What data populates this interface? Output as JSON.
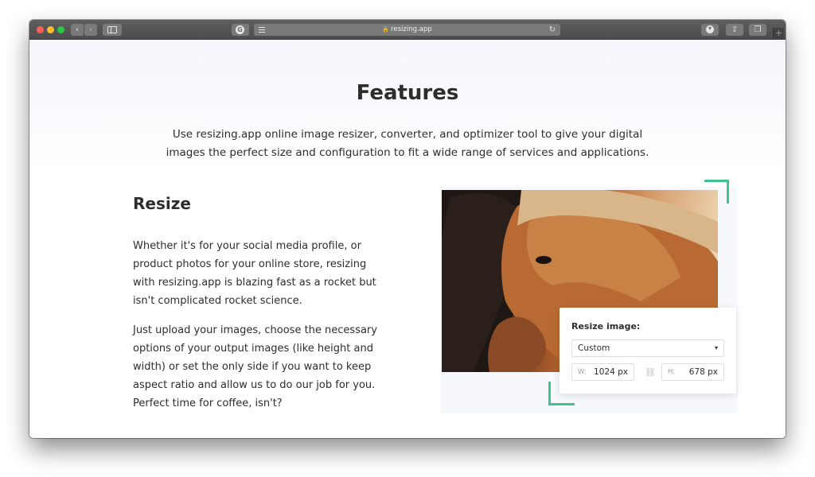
{
  "browser": {
    "url": "resizing.app",
    "lock_icon": "lock-icon",
    "reload_icon": "reload-icon",
    "back_icon": "chevron-left-icon",
    "forward_icon": "chevron-right-icon",
    "download_icon": "download-icon",
    "share_icon": "share-icon",
    "tabs_icon": "tabs-icon",
    "new_tab_icon": "plus-icon"
  },
  "features": {
    "title": "Features",
    "subtitle": "Use resizing.app online image resizer, converter, and optimizer tool to give your digital images the perfect size and configuration to fit a wide range of services and applications."
  },
  "resize_section": {
    "title": "Resize",
    "paragraph_1": "Whether it's for your social media profile, or product photos for your online store, resizing with resizing.app is blazing fast as a rocket but isn't complicated rocket science.",
    "paragraph_2": "Just upload your images, choose the necessary options of your output images (like height and width) or set the only side if you want to keep aspect ratio and allow us to do our job for you. Perfect time for coffee, isn't?"
  },
  "resize_card": {
    "title": "Resize image:",
    "mode_value": "Custom",
    "width_label": "W:",
    "width_value": "1024 px",
    "height_label": "H:",
    "height_value": "678 px"
  },
  "colors": {
    "accent": "#3ec28f",
    "text": "#2d2d2d"
  }
}
